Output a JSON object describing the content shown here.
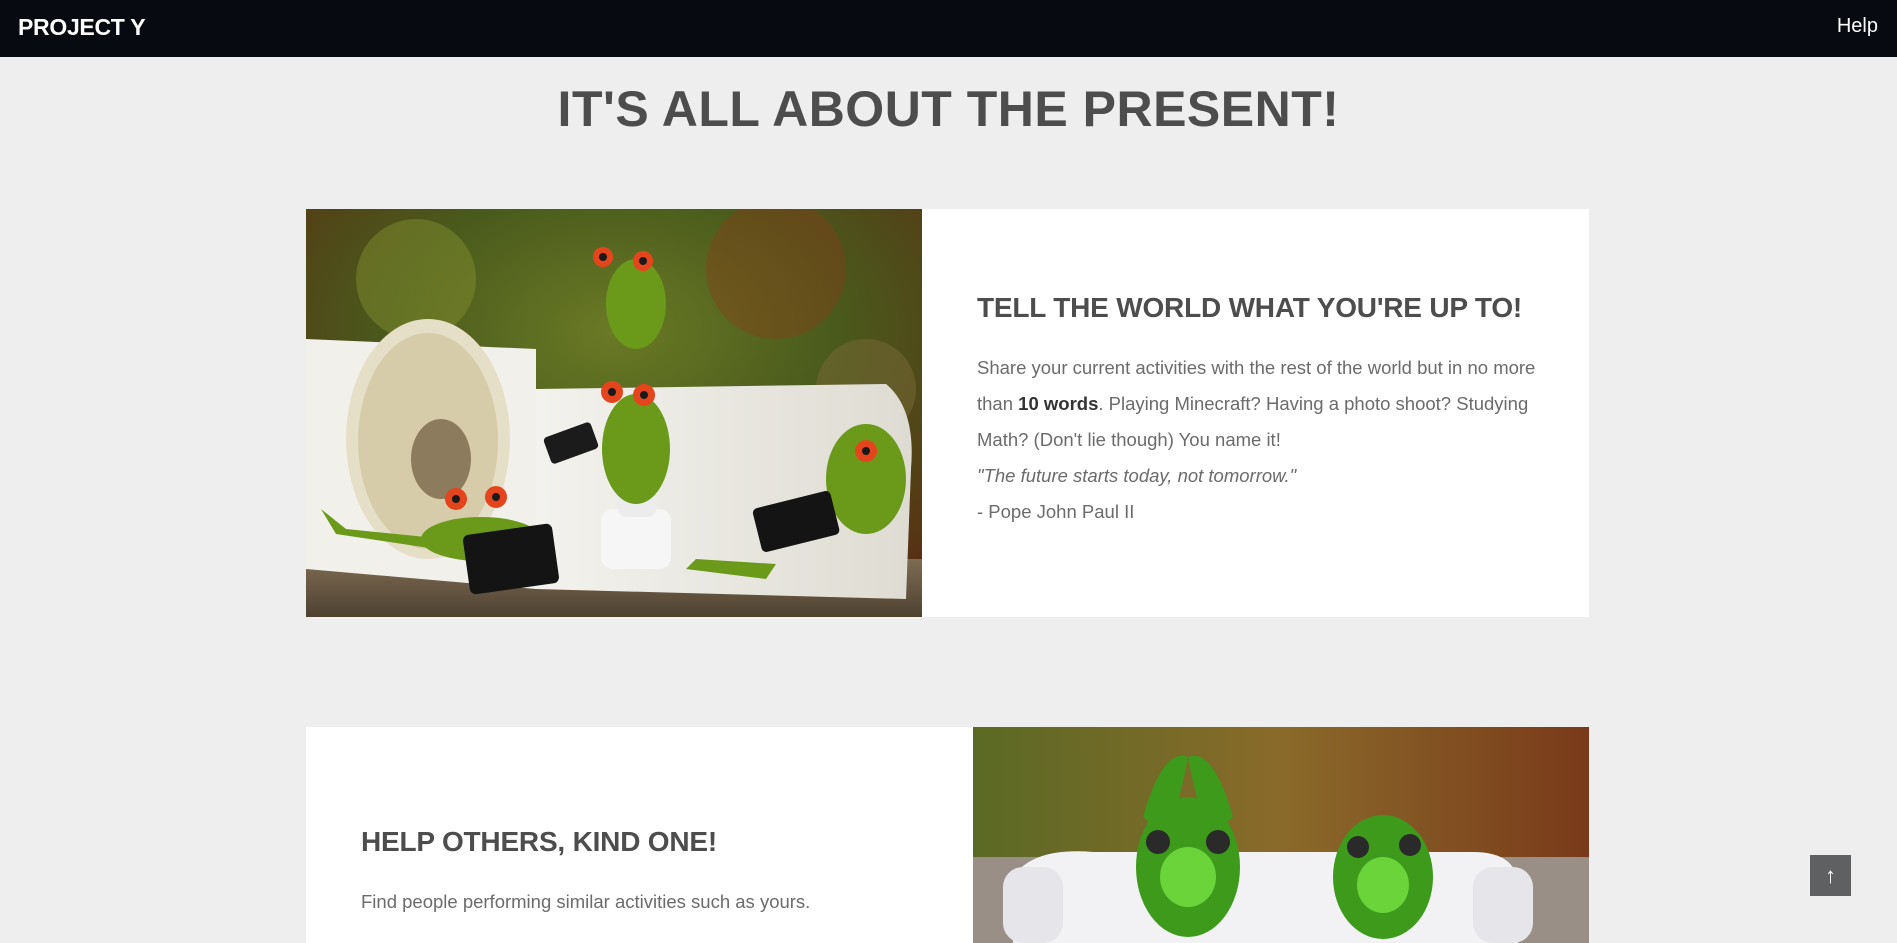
{
  "nav": {
    "brand": "PROJECT Y",
    "help": "Help"
  },
  "main": {
    "title": "IT'S ALL ABOUT THE PRESENT!"
  },
  "section1": {
    "heading": "TELL THE WORLD WHAT YOU'RE UP TO!",
    "text_before": "Share your current activities with the rest of the world but in no more than ",
    "text_bold": "10 words",
    "text_after": ". Playing Minecraft? Having a photo shoot? Studying Math? (Don't lie though) You name it!",
    "quote": "\"The future starts today, not tomorrow.\"",
    "author": "- Pope John Paul II"
  },
  "section2": {
    "heading": "HELP OTHERS, KIND ONE!",
    "text": "Find people performing similar activities such as yours."
  },
  "scroll_top": {
    "icon": "up-arrow-icon",
    "glyph": "↑"
  },
  "colors": {
    "navbar": "#070a10",
    "page_bg": "#eeeeee",
    "heading": "#4d4d4d",
    "body_text": "#6b6b6b",
    "scroll_button": "#5f6061"
  }
}
